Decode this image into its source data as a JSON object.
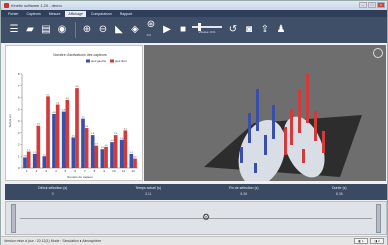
{
  "window": {
    "title": "Kinetic software 1.20 - demo",
    "buttons": [
      "–",
      "□",
      "×"
    ]
  },
  "menu": {
    "items": [
      "Fichier",
      "Capteurs",
      "Mesure",
      "Affichage",
      "Comparaison",
      "Rapport"
    ],
    "active_index": 3
  },
  "toolbar": {
    "icons": [
      "menu-icon",
      "open-icon",
      "save-icon",
      "record-icon",
      "zoom-in-icon",
      "zoom-out-icon",
      "chart-icon",
      "graph-icon",
      "cursor-icon",
      "play-icon",
      "stop-icon",
      "speed-slider",
      "replay-icon",
      "camera-icon",
      "export-icon",
      "person-icon"
    ],
    "speed_label": "Vitesse  ×1%",
    "zoom_label": "0.0"
  },
  "chart_data": {
    "type": "bar",
    "title": "Nombre d'activations des capteurs",
    "xlabel": "Numéro du capteur",
    "ylabel": "Temps (s)",
    "legend": [
      "pied gauche",
      "pied droit"
    ],
    "legend_position": "top-right",
    "categories": [
      "1",
      "2",
      "3",
      "4",
      "5",
      "6",
      "7",
      "8",
      "9",
      "10",
      "11",
      "12"
    ],
    "series": [
      {
        "name": "pied gauche",
        "color": "#3a4fa8",
        "values": [
          0.9,
          1.2,
          1.0,
          4.6,
          4.8,
          2.6,
          4.2,
          2.8,
          1.6,
          2.2,
          2.4,
          1.2
        ]
      },
      {
        "name": "pied droit",
        "color": "#d23b3b",
        "values": [
          1.4,
          3.6,
          6.1,
          5.4,
          5.8,
          6.8,
          3.4,
          1.9,
          1.8,
          2.8,
          3.2,
          0.8
        ]
      }
    ],
    "ylim": [
      0,
      8
    ],
    "yticks": [
      "0",
      "1",
      "2",
      "3",
      "4",
      "5",
      "6",
      "7",
      "8"
    ],
    "grid": false
  },
  "view3d": {
    "compass_label": "N"
  },
  "info": [
    {
      "label": "Début sélection (s)",
      "value": "0"
    },
    {
      "label": "Temps actuel (s)",
      "value": "3.11"
    },
    {
      "label": "Fin de sélection (s)",
      "value": "8.36"
    },
    {
      "label": "Durée (s)",
      "value": "8.36"
    }
  ],
  "statusbar": {
    "text": "Version mise à jour : 20.12(1)  Mode : Simulation  ♦  Atmosphère",
    "buttons": [
      "◧ 1",
      "◨ 2"
    ]
  }
}
